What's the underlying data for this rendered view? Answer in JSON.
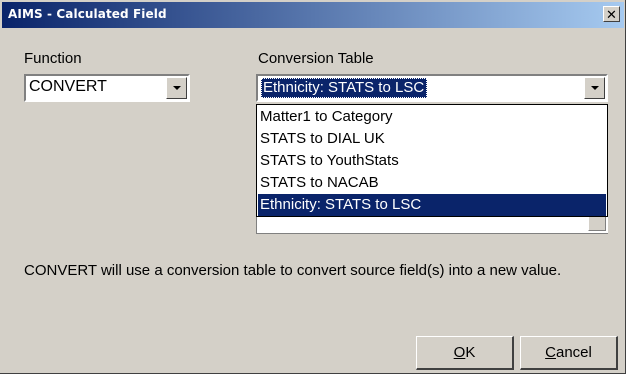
{
  "window": {
    "title": "AIMS - Calculated Field",
    "close_glyph": "✕"
  },
  "function": {
    "label": "Function",
    "value": "CONVERT"
  },
  "conversion_table": {
    "label": "Conversion Table",
    "value": "Ethnicity: STATS to LSC",
    "options": [
      "Matter1 to Category",
      "STATS to DIAL UK",
      "STATS to YouthStats",
      "STATS to NACAB",
      "Ethnicity: STATS to LSC"
    ],
    "selected_index": 4
  },
  "description": "CONVERT will use a conversion table to convert source field(s) into a new value.",
  "buttons": {
    "ok": {
      "mnemonic": "O",
      "rest": "K"
    },
    "cancel": {
      "mnemonic": "C",
      "rest": "ancel"
    }
  },
  "colors": {
    "title_gradient_start": "#0a246a",
    "title_gradient_end": "#a6caf0",
    "selection": "#0a246a",
    "face": "#d4d0c8"
  }
}
